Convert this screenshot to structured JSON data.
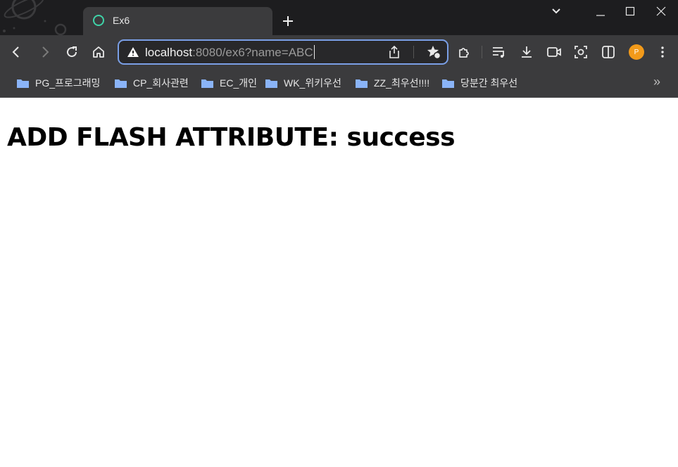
{
  "tab": {
    "title": "Ex6"
  },
  "address_bar": {
    "host": "localhost",
    "rest": ":8080/ex6?name=ABC"
  },
  "profile": {
    "initial": "P"
  },
  "bookmarks": [
    {
      "label": "PG_프로그래밍"
    },
    {
      "label": "CP_회사관련"
    },
    {
      "label": "EC_개인"
    },
    {
      "label": "WK_위키우선"
    },
    {
      "label": "ZZ_최우선!!!!"
    },
    {
      "label": "당분간 최우선"
    }
  ],
  "page": {
    "heading": "ADD FLASH ATTRIBUTE: success"
  },
  "colors": {
    "titlebar": "#1d1d1f",
    "toolbar": "#3b3b3d",
    "omnibox_border": "#7a9fe6",
    "favicon": "#3fd3a8",
    "avatar": "#f29a1a",
    "folder": "#8ab4f8"
  }
}
